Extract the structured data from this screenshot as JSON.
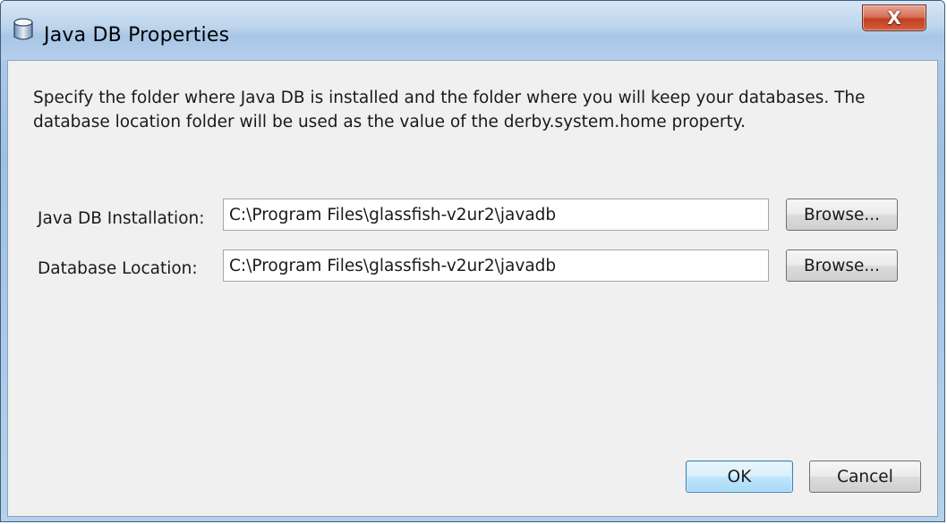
{
  "window": {
    "title": "Java DB Properties",
    "close_glyph": "X",
    "icon": "javadb-cylinder-icon"
  },
  "instructions": "Specify the folder where Java DB is installed and the folder where you will keep your databases. The database location folder will be used as the value of the derby.system.home property.",
  "fields": {
    "installation": {
      "label": "Java DB Installation:",
      "value": "C:\\Program Files\\glassfish-v2ur2\\javadb",
      "browse_label": "Browse..."
    },
    "location": {
      "label": "Database Location:",
      "value": "C:\\Program Files\\glassfish-v2ur2\\javadb",
      "browse_label": "Browse..."
    }
  },
  "buttons": {
    "ok_label": "OK",
    "cancel_label": "Cancel"
  },
  "colors": {
    "default_button_border": "#3c7fb1",
    "close_button": "#c2401f",
    "titlebar": "#bcd4ec"
  }
}
